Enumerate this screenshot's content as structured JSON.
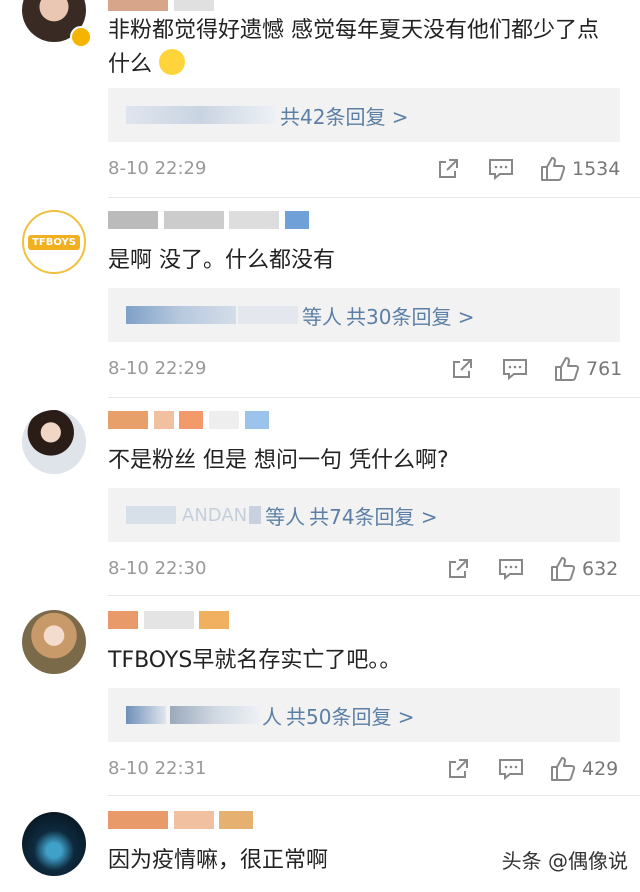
{
  "comments": [
    {
      "text": "非粉都觉得好遗憾 感觉每年夏天没有他们都少了点什么",
      "reply_names": "肿…… 等人",
      "reply_count": "共42条回复 >",
      "time": "8-10 22:29",
      "likes": "1534"
    },
    {
      "text": "是啊 没了。什么都没有",
      "reply_names": "啵啵…… 等人",
      "reply_count": "共30条回复 >",
      "time": "8-10 22:29",
      "likes": "761"
    },
    {
      "text": "不是粉丝 但是 想问一句 凭什么啊?",
      "reply_names": "我…… ANDAN 等人",
      "reply_count": "共74条回复 >",
      "time": "8-10 22:30",
      "likes": "632"
    },
    {
      "text": "TFBOYS早就名存实亡了吧。。",
      "reply_names": "…… 等人",
      "reply_count": "共50条回复 >",
      "time": "8-10 22:31",
      "likes": "429"
    },
    {
      "text": "因为疫情嘛，很正常啊"
    }
  ],
  "avatar2_logo": "TFBOYS",
  "watermark": "头条 @偶像说"
}
